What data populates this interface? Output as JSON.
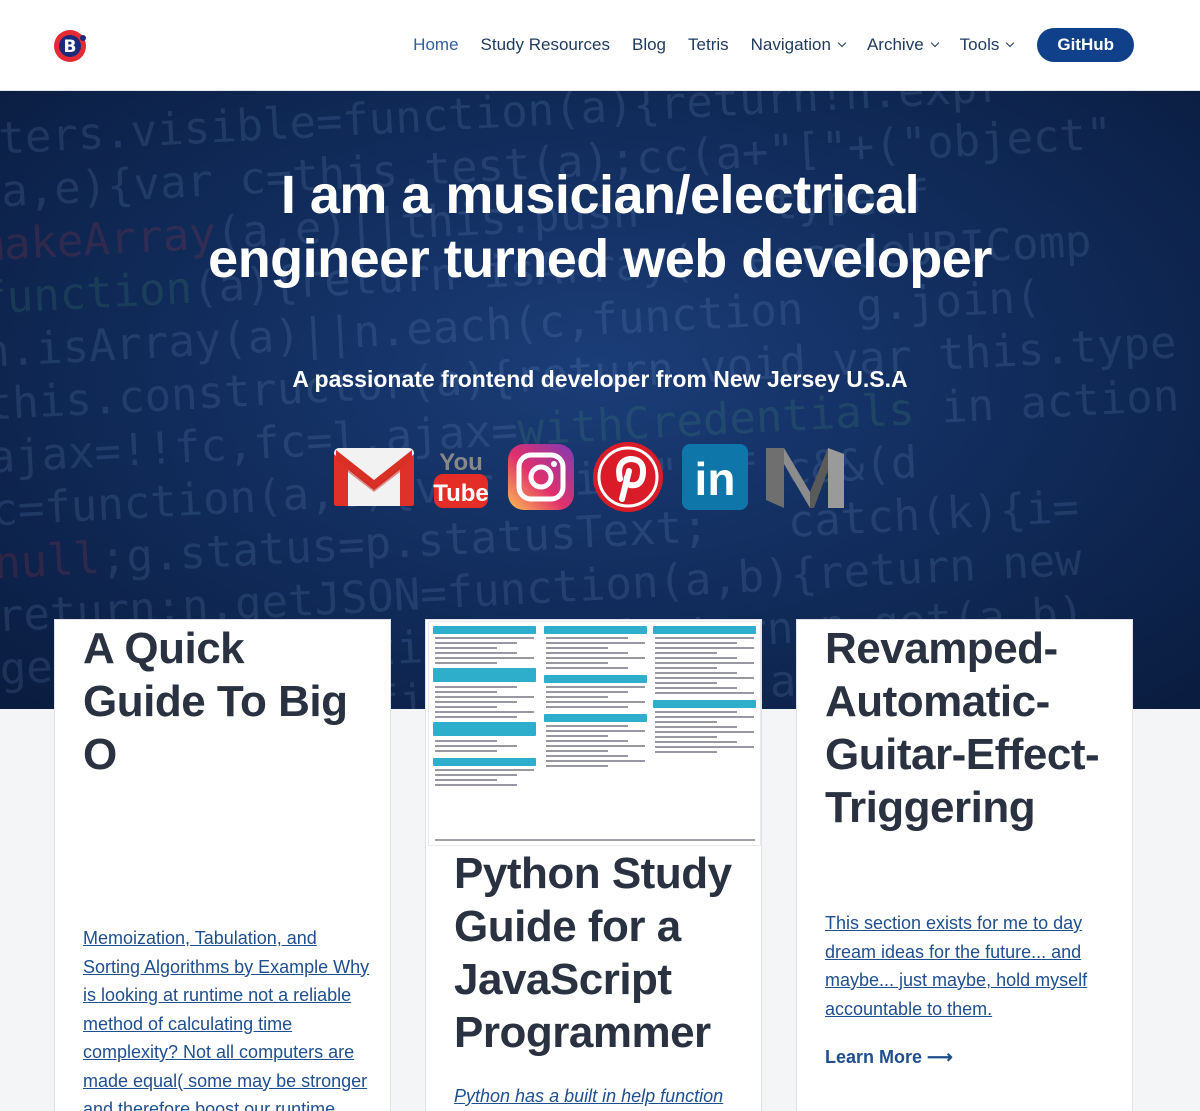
{
  "header": {
    "nav": [
      {
        "label": "Home",
        "active": true,
        "has_dropdown": false
      },
      {
        "label": "Study Resources",
        "active": false,
        "has_dropdown": false
      },
      {
        "label": "Blog",
        "active": false,
        "has_dropdown": false
      },
      {
        "label": "Tetris",
        "active": false,
        "has_dropdown": false
      },
      {
        "label": "Navigation",
        "active": false,
        "has_dropdown": true
      },
      {
        "label": "Archive",
        "active": false,
        "has_dropdown": true
      },
      {
        "label": "Tools",
        "active": false,
        "has_dropdown": true
      }
    ],
    "github_label": "GitHub"
  },
  "hero": {
    "title": "I am a musician/electrical engineer turned web developer",
    "subtitle": "A passionate frontend developer from New Jersey U.S.A",
    "socials": [
      {
        "icon": "gmail-icon"
      },
      {
        "icon": "youtube-icon",
        "text_top": "You",
        "text_bottom": "Tube"
      },
      {
        "icon": "instagram-icon"
      },
      {
        "icon": "pinterest-icon"
      },
      {
        "icon": "linkedin-icon",
        "text": "in"
      },
      {
        "icon": "medium-icon"
      }
    ]
  },
  "cards": [
    {
      "title": "A Quick Guide To Big O",
      "excerpt": "Memoization, Tabulation, and Sorting Algorithms by Example Why is looking at runtime not a reliable method of calculating time complexity? Not all computers are made equal( some may be stronger and therefore boost our runtime"
    },
    {
      "title": "Python Study Guide for a JavaScript Programmer",
      "excerpt": "Python has a built in help function",
      "image": "python-cheatsheet-thumbnail"
    },
    {
      "title": "Revamped-Automatic-Guitar-Effect-Triggering",
      "excerpt": "This section exists for me to day dream ideas for the future... and maybe... just maybe, hold myself accountable to them.",
      "cta": "Learn More ⟶"
    }
  ],
  "colors": {
    "accent": "#10408a",
    "link": "#1f4f8f",
    "hero_bg": "#102a58"
  }
}
